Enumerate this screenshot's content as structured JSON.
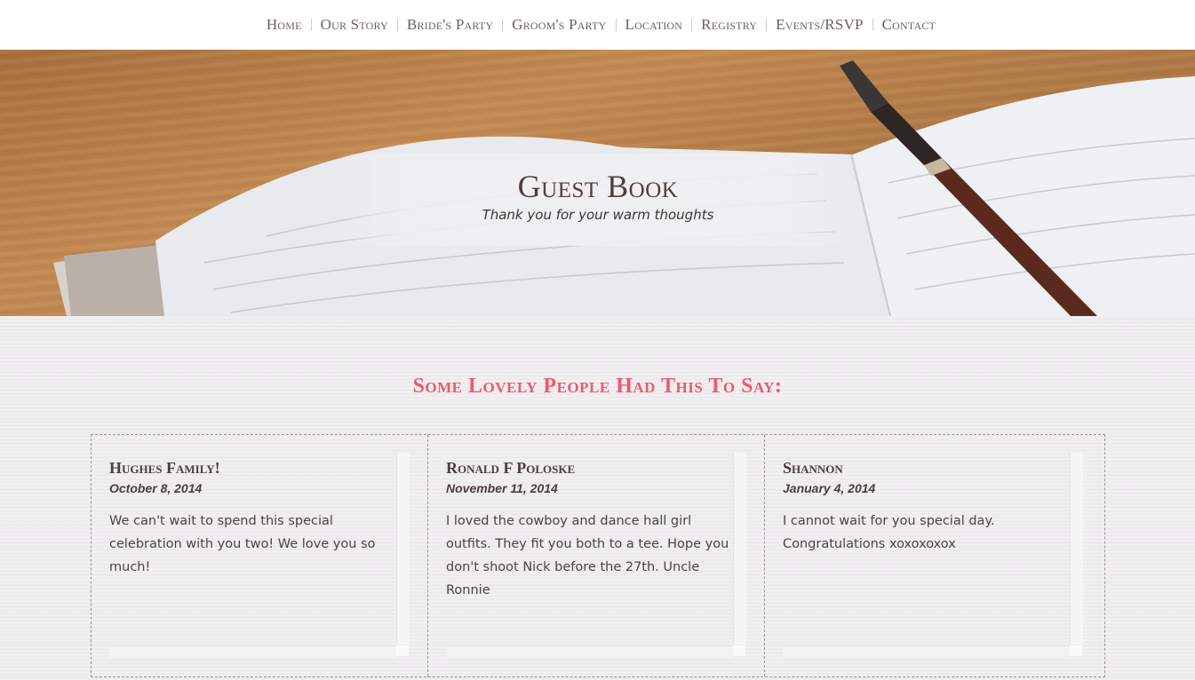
{
  "nav": {
    "items": [
      "Home",
      "Our Story",
      "Bride's Party",
      "Groom's Party",
      "Location",
      "Registry",
      "Events/RSVP",
      "Contact"
    ]
  },
  "hero": {
    "title": "Guest Book",
    "subtitle": "Thank you for your warm thoughts"
  },
  "guestbook": {
    "heading": "Some Lovely People Had This To Say:",
    "entries": [
      {
        "name": "Hughes Family!",
        "date": "October 8, 2014",
        "message": "We can't wait to spend this special celebration with you two! We love you so much!"
      },
      {
        "name": "Ronald F Poloske",
        "date": "November 11, 2014",
        "message": "I loved the cowboy and dance hall girl outfits. They fit you both to a tee. Hope you don't shoot Nick before the 27th. Uncle Ronnie"
      },
      {
        "name": "Shannon",
        "date": "January 4, 2014",
        "message": "I cannot wait for you special day. Congratulations xoxoxoxox"
      }
    ]
  },
  "colors": {
    "accent": "#ee5a6a",
    "text_dark": "#4a3e3c",
    "nav_text": "#6a5f5f"
  }
}
